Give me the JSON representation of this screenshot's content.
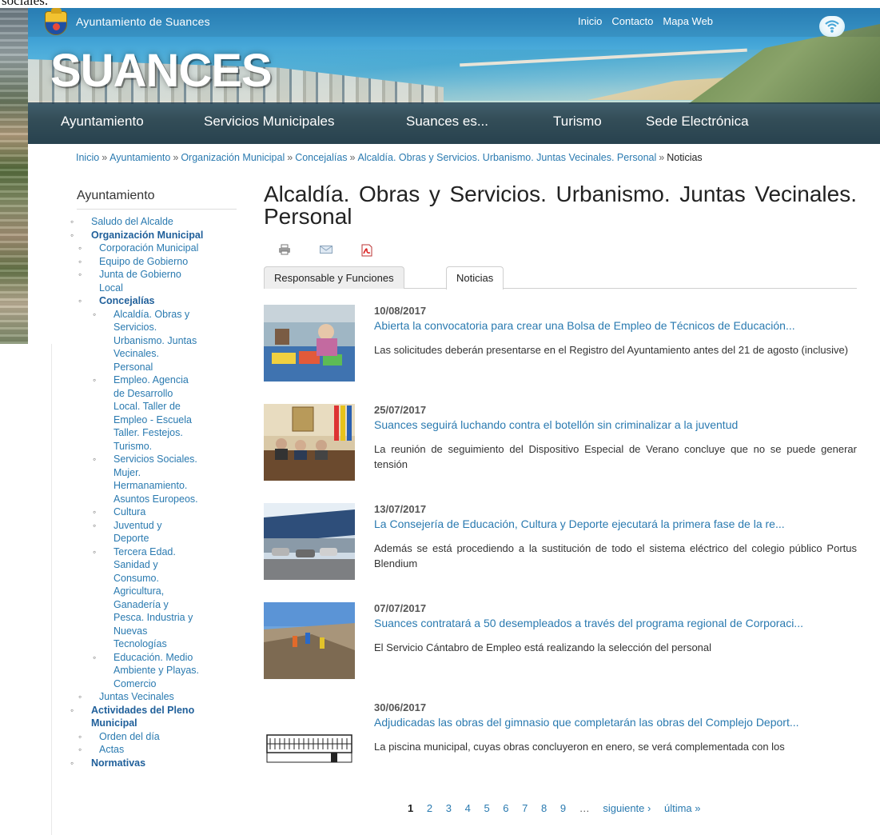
{
  "header": {
    "site_title": "Ayuntamiento de Suances",
    "logo_text": "SUANCES",
    "util_links": [
      "Inicio",
      "Contacto",
      "Mapa Web"
    ]
  },
  "nav": {
    "items": [
      "Ayuntamiento",
      "Servicios Municipales",
      "Suances es...",
      "Turismo",
      "Sede Electrónica"
    ]
  },
  "breadcrumb": {
    "items": [
      "Inicio",
      "Ayuntamiento",
      "Organización Municipal",
      "Concejalías",
      "Alcaldía. Obras y Servicios. Urbanismo. Juntas Vecinales. Personal"
    ],
    "separator": "»",
    "current": "Noticias"
  },
  "sidebar": {
    "title": "Ayuntamiento",
    "items": [
      {
        "level": 1,
        "bold": false,
        "lines": [
          "Saludo del Alcalde"
        ]
      },
      {
        "level": 1,
        "bold": true,
        "lines": [
          "Organización Municipal"
        ]
      },
      {
        "level": 2,
        "bold": false,
        "lines": [
          "Corporación Municipal"
        ]
      },
      {
        "level": 2,
        "bold": false,
        "lines": [
          "Equipo de Gobierno"
        ]
      },
      {
        "level": 2,
        "bold": false,
        "lines": [
          "Junta de Gobierno",
          "Local"
        ]
      },
      {
        "level": 2,
        "bold": true,
        "lines": [
          "Concejalías"
        ]
      },
      {
        "level": 3,
        "bold": false,
        "lines": [
          "Alcaldía. Obras y",
          "Servicios.",
          "Urbanismo. Juntas",
          "Vecinales.",
          "Personal"
        ]
      },
      {
        "level": 3,
        "bold": false,
        "lines": [
          "Empleo. Agencia",
          "de Desarrollo",
          "Local. Taller de",
          "Empleo - Escuela",
          "Taller. Festejos.",
          "Turismo."
        ]
      },
      {
        "level": 3,
        "bold": false,
        "lines": [
          "Servicios Sociales.",
          "Mujer.",
          "Hermanamiento.",
          "Asuntos Europeos."
        ]
      },
      {
        "level": 3,
        "bold": false,
        "lines": [
          "Cultura"
        ]
      },
      {
        "level": 3,
        "bold": false,
        "lines": [
          "Juventud y",
          "Deporte"
        ]
      },
      {
        "level": 3,
        "bold": false,
        "lines": [
          "Tercera Edad.",
          "Sanidad y",
          "Consumo.",
          "Agricultura,",
          "Ganadería y",
          "Pesca. Industria y",
          "Nuevas",
          "Tecnologías"
        ]
      },
      {
        "level": 3,
        "bold": false,
        "lines": [
          "Educación. Medio",
          "Ambiente y Playas.",
          "Comercio"
        ]
      },
      {
        "level": 2,
        "bold": false,
        "lines": [
          "Juntas Vecinales"
        ]
      },
      {
        "level": 1,
        "bold": true,
        "lines": [
          "Actividades del Pleno",
          "Municipal"
        ]
      },
      {
        "level": 2,
        "bold": false,
        "lines": [
          "Orden del día"
        ]
      },
      {
        "level": 2,
        "bold": false,
        "lines": [
          "Actas"
        ]
      },
      {
        "level": 1,
        "bold": true,
        "lines": [
          "Normativas"
        ]
      }
    ]
  },
  "main": {
    "title": "Alcaldía. Obras y Servicios. Urbanismo. Juntas Vecinales. Personal",
    "tools": [
      "print-icon",
      "email-icon",
      "pdf-icon"
    ],
    "tabs": [
      {
        "label": "Responsable y Funciones",
        "active": false
      },
      {
        "label": "Noticias",
        "active": true
      }
    ],
    "news": [
      {
        "date": "10/08/2017",
        "title": "Abierta la convocatoria para crear una Bolsa de Empleo de Técnicos de Educación...",
        "summary": "Las solicitudes deberán presentarse en el Registro del Ayuntamiento antes del 21 de agosto (inclusive)"
      },
      {
        "date": "25/07/2017",
        "title": "Suances seguirá luchando contra el botellón sin criminalizar a la juventud",
        "summary": "La reunión de seguimiento  del Dispositivo Especial de Verano concluye que no se puede generar tensión"
      },
      {
        "date": "13/07/2017",
        "title": "La Consejería de Educación, Cultura y Deporte ejecutará la primera fase de la re...",
        "summary": "Además se está procediendo a la sustitución de todo el sistema eléctrico del colegio público Portus Blendium"
      },
      {
        "date": "07/07/2017",
        "title": "Suances contratará a 50 desempleados a través del programa regional de Corporaci...",
        "summary": "El Servicio Cántabro de Empleo está realizando la selección del personal"
      },
      {
        "date": "30/06/2017",
        "title": "Adjudicadas las obras del gimnasio que completarán las obras del Complejo Deport...",
        "summary": "La piscina municipal, cuyas obras concluyeron en enero, se verá complementada con los"
      }
    ]
  },
  "pager": {
    "pages": [
      "1",
      "2",
      "3",
      "4",
      "5",
      "6",
      "7",
      "8",
      "9"
    ],
    "current": "1",
    "ellipsis": "…",
    "next": "siguiente ›",
    "last": "última »"
  },
  "colors": {
    "link": "#2a7ab0",
    "nav_bg": "#19374b",
    "text": "#333333"
  }
}
